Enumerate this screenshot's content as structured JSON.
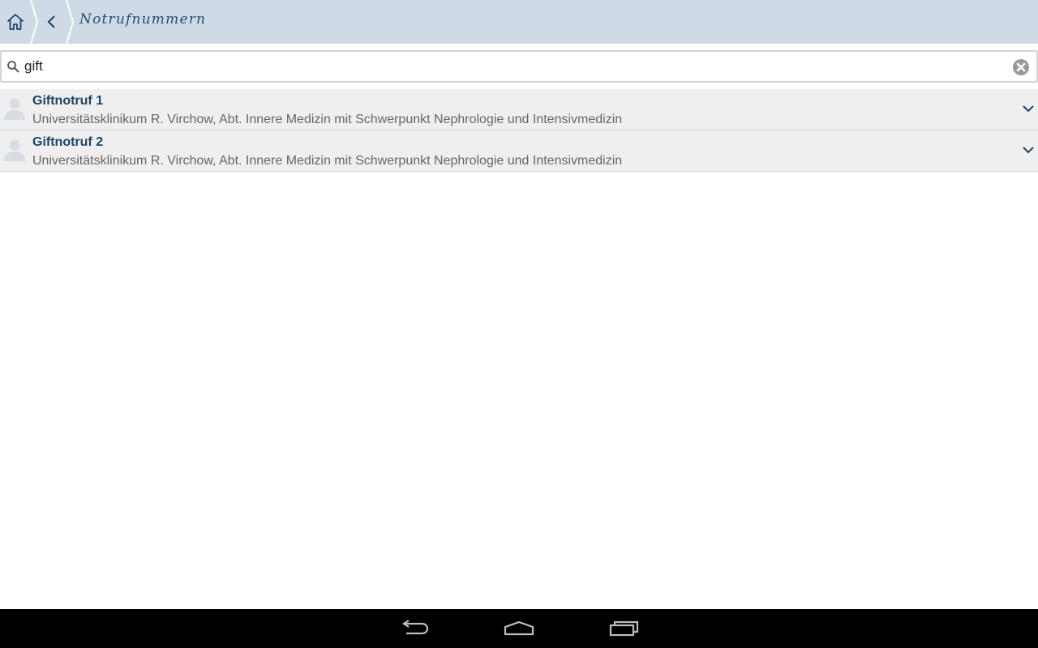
{
  "header": {
    "title": "Notrufnummern",
    "home_icon": "home-icon",
    "back_icon": "chevron-left-icon"
  },
  "search": {
    "value": "gift",
    "search_icon": "search-icon",
    "clear_icon": "clear-circle-icon"
  },
  "results": [
    {
      "title": "Giftnotruf 1",
      "subtitle": "Universitätsklinikum R. Virchow, Abt. Innere Medizin mit Schwerpunkt Nephrologie und Intensivmedizin",
      "avatar_icon": "person-icon",
      "expand_icon": "chevron-down-icon"
    },
    {
      "title": "Giftnotruf 2",
      "subtitle": "Universitätsklinikum R. Virchow, Abt. Innere Medizin mit Schwerpunkt Nephrologie und Intensivmedizin",
      "avatar_icon": "person-icon",
      "expand_icon": "chevron-down-icon"
    }
  ],
  "navigation": {
    "back_icon": "android-back-icon",
    "home_icon": "android-home-icon",
    "recents_icon": "android-recents-icon"
  },
  "colors": {
    "header_bg": "#cfdae6",
    "accent": "#1d4466",
    "list_bg": "#efefef"
  }
}
